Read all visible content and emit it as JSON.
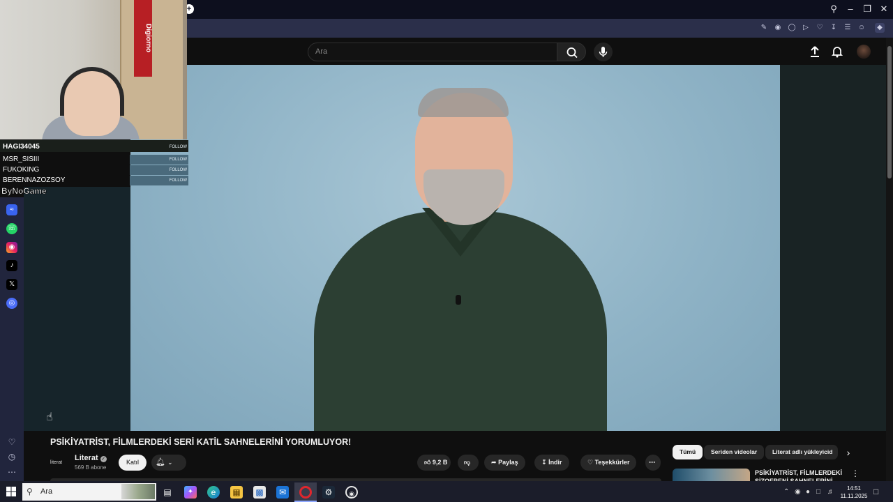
{
  "overlay": {
    "brand": "ByNoGame",
    "follow_label": "FOLLOW",
    "followers": [
      "HAGI34045",
      "MSR_SISIII",
      "FUKOKING",
      "BERENNAZOZSOY"
    ],
    "flag_text": "Digiorno"
  },
  "social_icons": [
    "messenger-icon",
    "whatsapp-icon",
    "instagram-icon",
    "tiktok-icon",
    "x-icon",
    "app-icon"
  ],
  "youtube": {
    "search_placeholder": "Ara",
    "video_title": "PSİKİYATRİST, FİLMLERDEKİ SERİ KATİL SAHNELERİNİ YORUMLUYOR!",
    "channel": {
      "logo_text": "literat",
      "name": "Literat",
      "subscribers": "569 B abone",
      "join_label": "Katıl"
    },
    "actions": {
      "likes": "9,2 B",
      "share": "Paylaş",
      "download": "İndir",
      "thanks": "Teşekkürler"
    },
    "chips": [
      "Tümü",
      "Seriden videolar",
      "Literat adlı yükleyicid"
    ],
    "recommended": {
      "title": "PSİKİYATRİST, FİLMLERDEKİ ŞİZOFRENİ SAHNELERİNİ"
    }
  },
  "taskbar": {
    "search_placeholder": "Ara",
    "time": "14:51",
    "date": "11.11.2025"
  },
  "colors": {
    "browser_titlebar": "#0d0f1e",
    "browser_addressbar": "#2b2f4a",
    "youtube_bg": "#0f0f0f",
    "accent_active_tab": "#8ea8ff"
  }
}
